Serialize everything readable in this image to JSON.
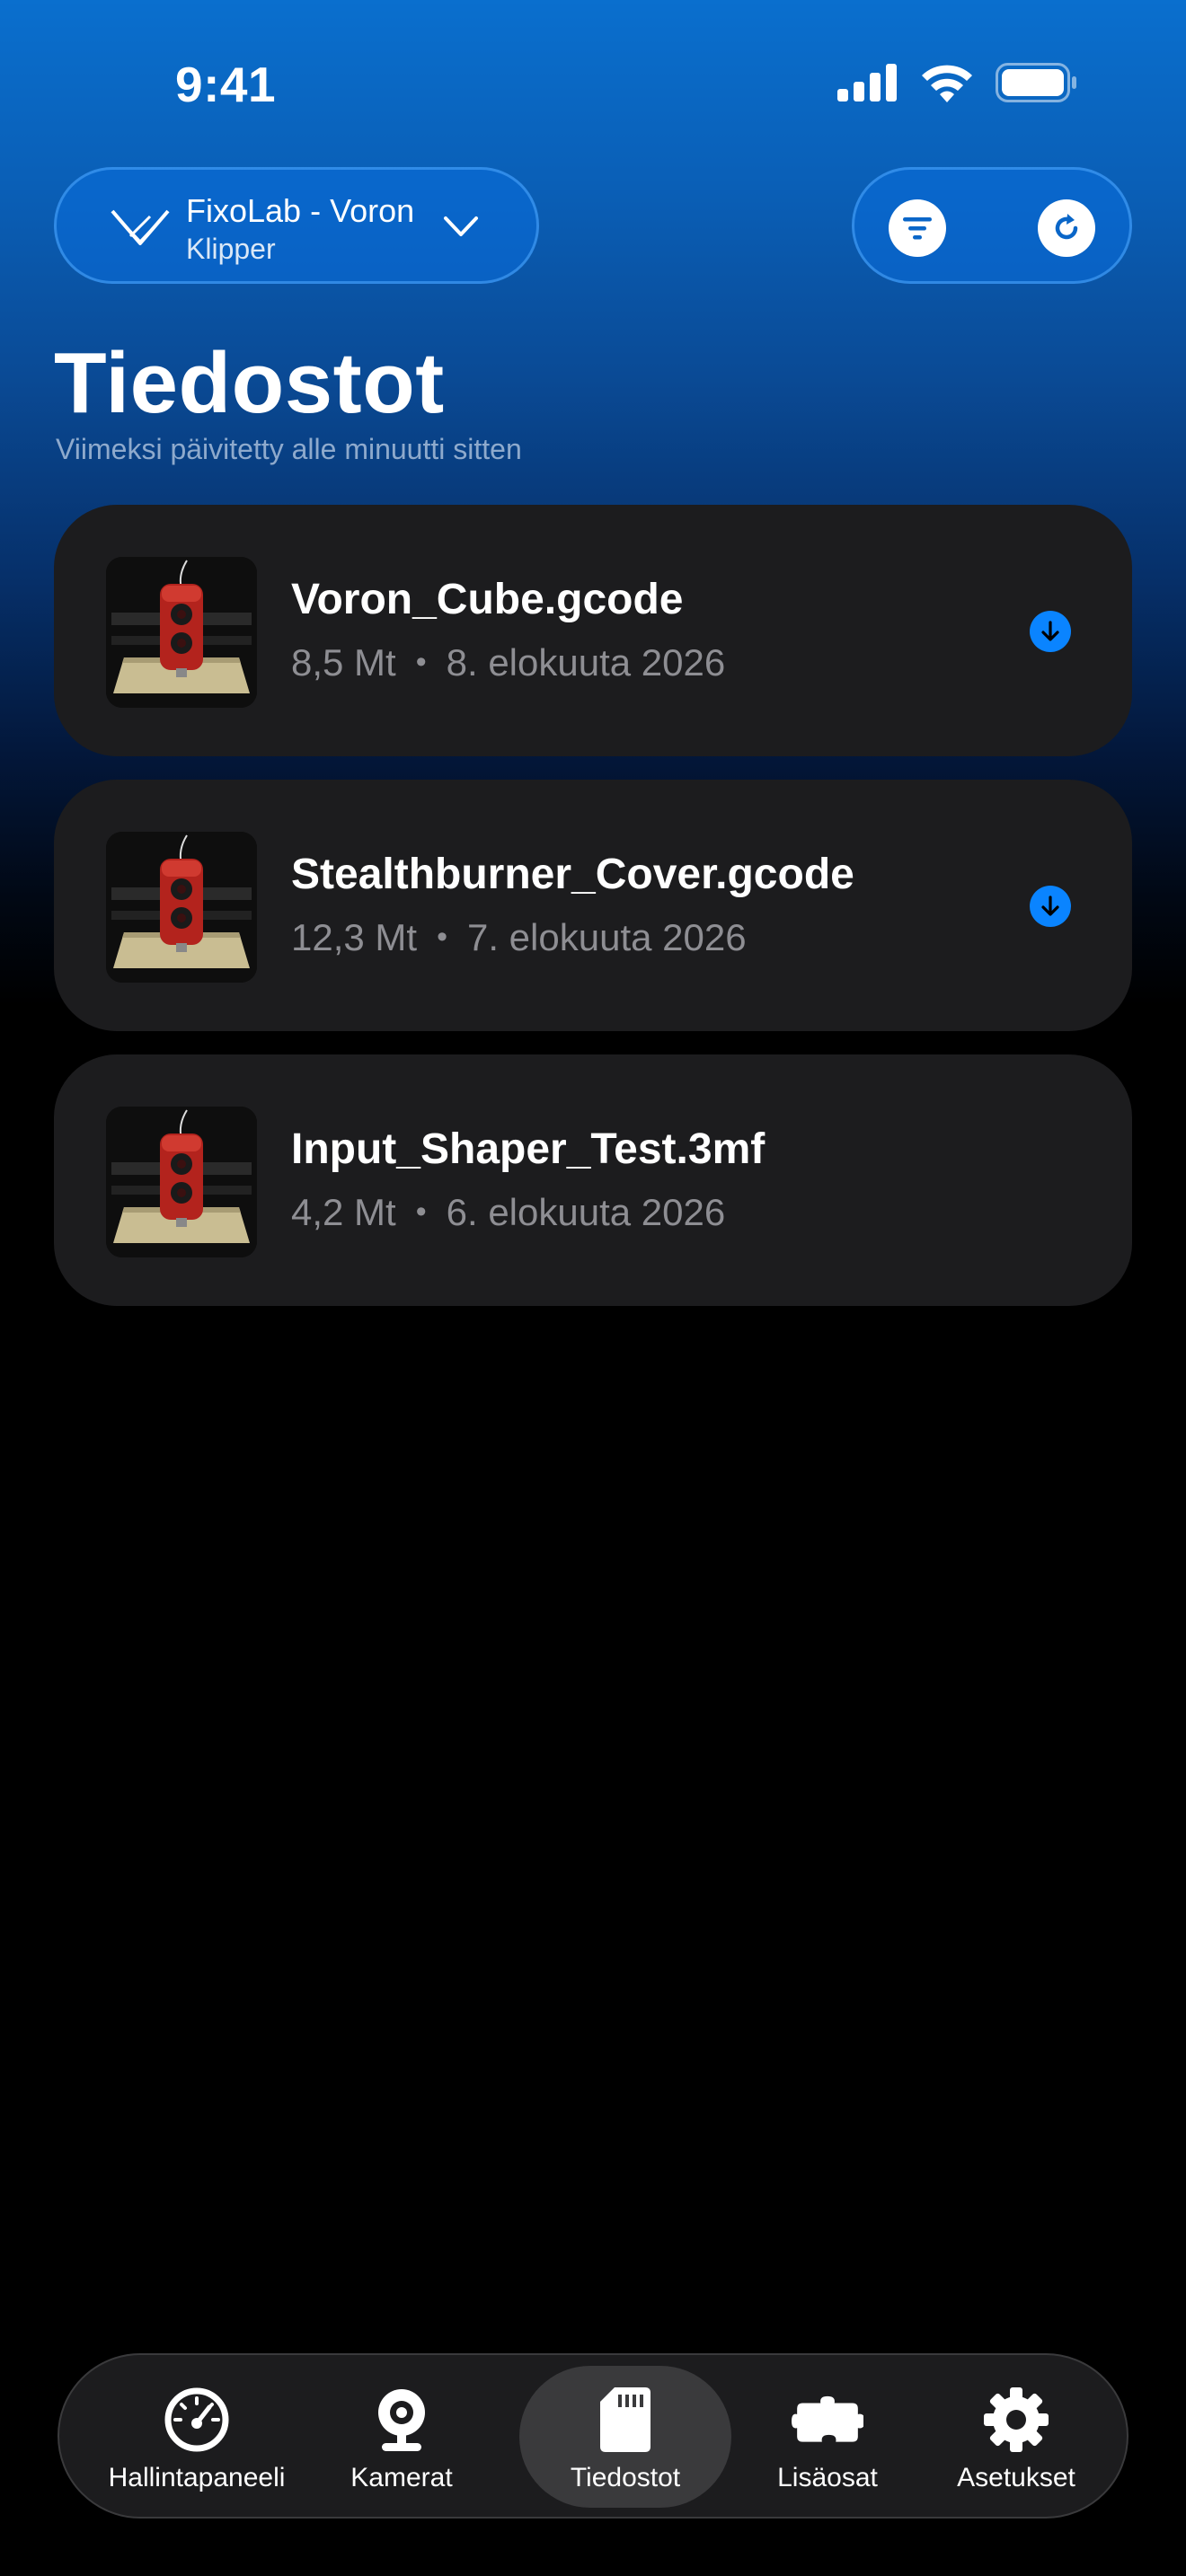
{
  "status_bar": {
    "time": "9:41"
  },
  "printer_selector": {
    "name": "FixoLab - Voron",
    "firmware": "Klipper"
  },
  "header": {
    "title": "Tiedostot",
    "subtitle": "Viimeksi päivitetty alle minuutti sitten"
  },
  "files": [
    {
      "name": "Voron_Cube.gcode",
      "size": "8,5 Mt",
      "date": "8. elokuuta 2026",
      "downloaded": true
    },
    {
      "name": "Stealthburner_Cover.gcode",
      "size": "12,3 Mt",
      "date": "7. elokuuta 2026",
      "downloaded": true
    },
    {
      "name": "Input_Shaper_Test.3mf",
      "size": "4,2 Mt",
      "date": "6. elokuuta 2026",
      "downloaded": false
    }
  ],
  "meta_separator": "•",
  "tab_bar": {
    "active": "Tiedostot",
    "tabs": [
      {
        "label": "Hallintapaneeli",
        "icon": "gauge-icon"
      },
      {
        "label": "Kamerat",
        "icon": "webcam-icon"
      },
      {
        "label": "Tiedostot",
        "icon": "sd-card-icon"
      },
      {
        "label": "Lisäosat",
        "icon": "puzzle-icon"
      },
      {
        "label": "Asetukset",
        "icon": "gear-icon"
      }
    ]
  },
  "colors": {
    "accent": "#0a84ff",
    "card_background": "#1c1c1e",
    "secondary_text": "#8e8e93"
  }
}
